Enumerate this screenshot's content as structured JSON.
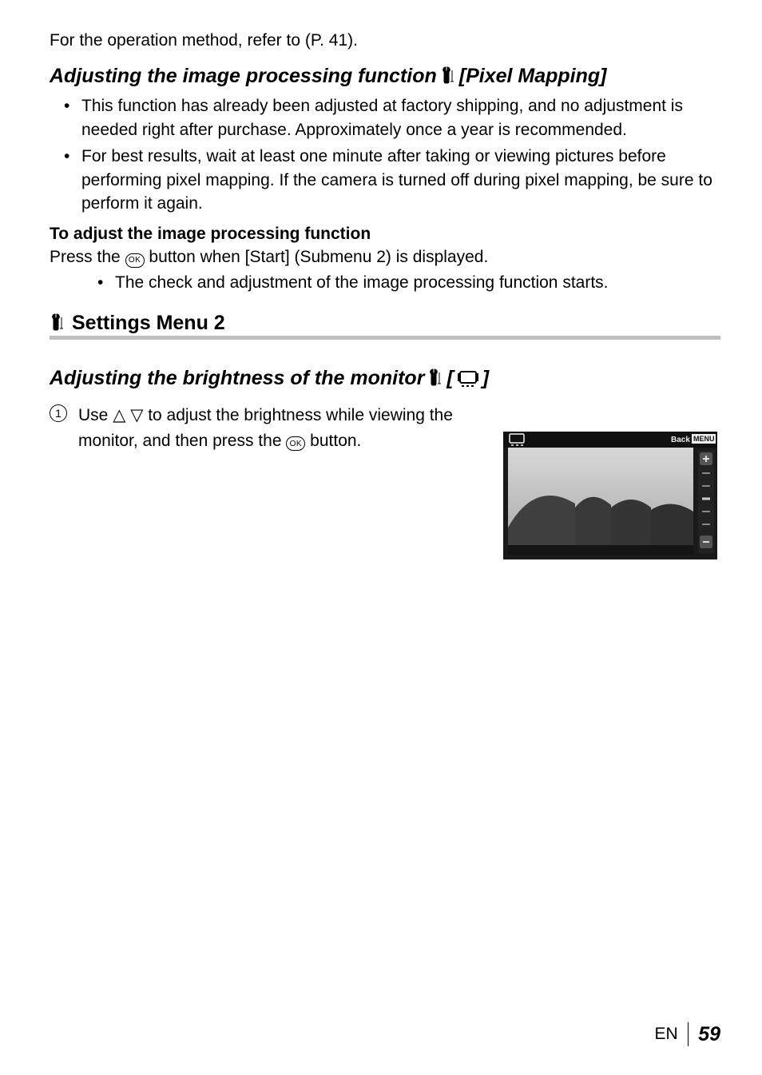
{
  "intro_line": "For the operation method, refer to (P. 41).",
  "heading1_pre": "Adjusting the image processing function ",
  "heading1_post": " [Pixel Mapping]",
  "bullets1": [
    "This function has already been adjusted at factory shipping, and no adjustment is needed right after purchase. Approximately once a year is recommended.",
    "For best results, wait at least one minute after taking or viewing pictures before performing pixel mapping. If the camera is turned off during pixel mapping, be sure to perform it again."
  ],
  "subheading1": "To adjust the image processing function",
  "press_pre": "Press the ",
  "press_post": " button when [Start] (Submenu 2) is displayed.",
  "press_bullet": "The check and adjustment of the image processing function starts.",
  "section_title": " Settings Menu 2",
  "heading2_pre": "Adjusting the brightness of the monitor ",
  "heading2_bracket_open": " [",
  "heading2_bracket_close": "]",
  "step_num": "1",
  "step_pre": "Use ",
  "step_mid": " to adjust the brightness while viewing the monitor, and then press the ",
  "step_post": " button.",
  "ok_label": "OK",
  "screenshot": {
    "back_label": "Back",
    "menu_label": "MENU"
  },
  "footer_lang": "EN",
  "footer_page": "59"
}
